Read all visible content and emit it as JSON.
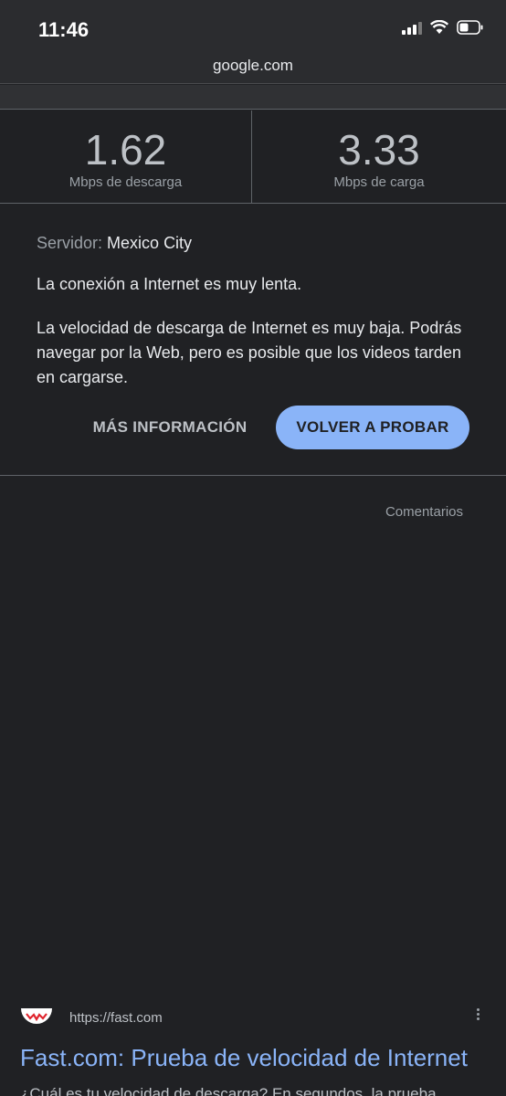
{
  "status_bar": {
    "time": "11:46",
    "icons": [
      "signal-icon",
      "wifi-icon",
      "battery-icon"
    ]
  },
  "browser": {
    "url": "google.com"
  },
  "speed_test": {
    "download": {
      "value": "1.62",
      "unit": "Mbps de descarga"
    },
    "upload": {
      "value": "3.33",
      "unit": "Mbps de carga"
    },
    "server_label": "Servidor:",
    "server_value": "Mexico City",
    "verdict": "La conexión a Internet es muy lenta.",
    "description": "La velocidad de descarga de Internet es muy baja. Podrás navegar por la Web, pero es posible que los videos tarden en cargarse.",
    "more_info_label": "MÁS INFORMACIÓN",
    "retry_label": "VOLVER A PROBAR",
    "feedback_label": "Comentarios"
  },
  "search_result": {
    "url": "https://fast.com",
    "title": "Fast.com: Prueba de velocidad de Internet",
    "snippet": "¿Cuál es tu velocidad de descarga? En segundos, la prueba",
    "favicon": "fast-logo-icon"
  },
  "colors": {
    "background": "#202124",
    "accent": "#8ab4f8",
    "link": "#8ab4f8"
  }
}
